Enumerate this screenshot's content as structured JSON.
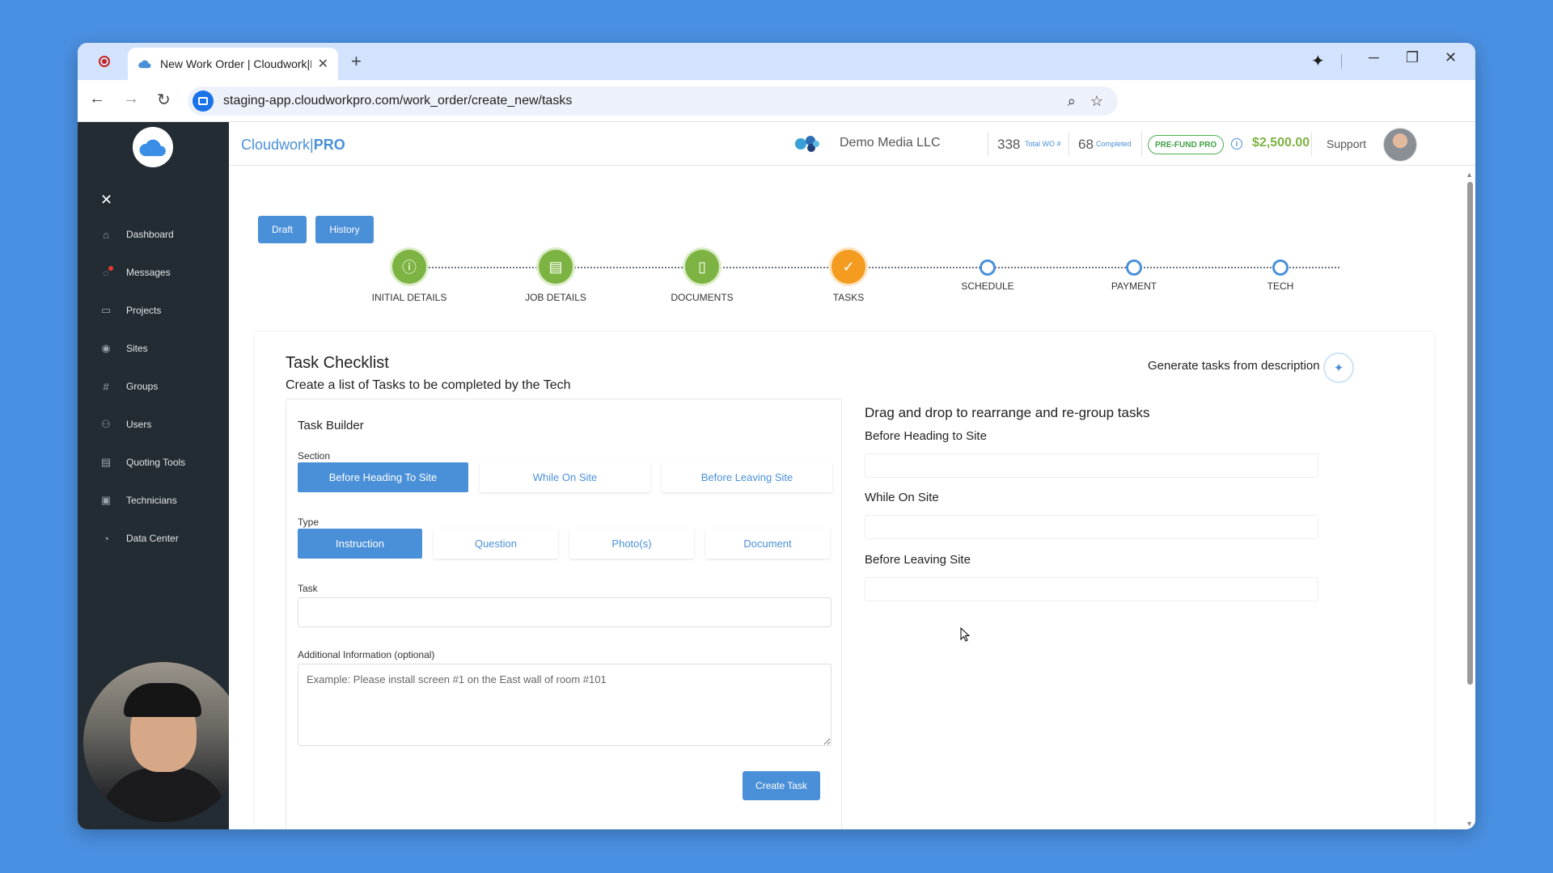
{
  "browser": {
    "tab_title": "New Work Order | Cloudwork|P",
    "new_tab": "+",
    "url": "staging-app.cloudworkpro.com/work_order/create_new/tasks",
    "icons": [
      "record-icon",
      "cloud-favicon",
      "close-icon",
      "gemini-icon",
      "minimize-icon",
      "restore-icon",
      "window-close-icon",
      "back-icon",
      "forward-icon",
      "reload-icon",
      "zoom-icon",
      "bookmark-star-icon"
    ]
  },
  "brand": {
    "name": "Cloudwork|",
    "suffix": "PRO"
  },
  "header": {
    "company": "Demo Media LLC",
    "total_wo_count": "338",
    "total_wo_label": "Total WO #",
    "completed_count": "68",
    "completed_label": "Completed",
    "prefund_badge": "PRE-FUND PRO",
    "amount": "$2,500.00",
    "support": "Support"
  },
  "sidebar": {
    "close": "✕",
    "items": [
      {
        "label": "Dashboard",
        "icon": "home-icon"
      },
      {
        "label": "Messages",
        "icon": "chat-icon"
      },
      {
        "label": "Projects",
        "icon": "folder-icon"
      },
      {
        "label": "Sites",
        "icon": "map-pin-icon"
      },
      {
        "label": "Groups",
        "icon": "hash-icon"
      },
      {
        "label": "Users",
        "icon": "users-icon"
      },
      {
        "label": "Quoting Tools",
        "icon": "calculator-icon"
      },
      {
        "label": "Technicians",
        "icon": "id-card-icon"
      },
      {
        "label": "Data Center",
        "icon": "chart-pie-icon"
      }
    ]
  },
  "buttons": {
    "draft": "Draft",
    "history": "History",
    "create_task": "Create Task"
  },
  "steps": [
    {
      "label": "INITIAL DETAILS",
      "state": "done",
      "icon": "info-icon"
    },
    {
      "label": "JOB DETAILS",
      "state": "done",
      "icon": "clipboard-icon"
    },
    {
      "label": "DOCUMENTS",
      "state": "done",
      "icon": "document-icon"
    },
    {
      "label": "TASKS",
      "state": "active",
      "icon": "clipboard-check-icon"
    },
    {
      "label": "SCHEDULE",
      "state": "pending"
    },
    {
      "label": "PAYMENT",
      "state": "pending"
    },
    {
      "label": "TECH",
      "state": "pending"
    }
  ],
  "checklist": {
    "title": "Task Checklist",
    "subtitle": "Create a list of Tasks to be completed by the Tech",
    "generate_label": "Generate tasks from description"
  },
  "builder": {
    "title": "Task Builder",
    "section_label": "Section",
    "sections": [
      "Before Heading To Site",
      "While On Site",
      "Before Leaving Site"
    ],
    "selected_section": "Before Heading To Site",
    "type_label": "Type",
    "types": [
      "Instruction",
      "Question",
      "Photo(s)",
      "Document"
    ],
    "selected_type": "Instruction",
    "task_label": "Task",
    "task_value": "",
    "additional_label": "Additional Information (optional)",
    "additional_placeholder": "Example: Please install screen #1 on the East wall of room #101"
  },
  "dnd": {
    "title": "Drag and drop to rearrange and re-group tasks",
    "sections": [
      "Before Heading to Site",
      "While On Site",
      "Before Leaving Site"
    ]
  },
  "colors": {
    "accent": "#4a90d9",
    "done": "#7cb342",
    "active": "#f39c1f",
    "sidebar": "#232c33",
    "background": "#4a90e2"
  }
}
